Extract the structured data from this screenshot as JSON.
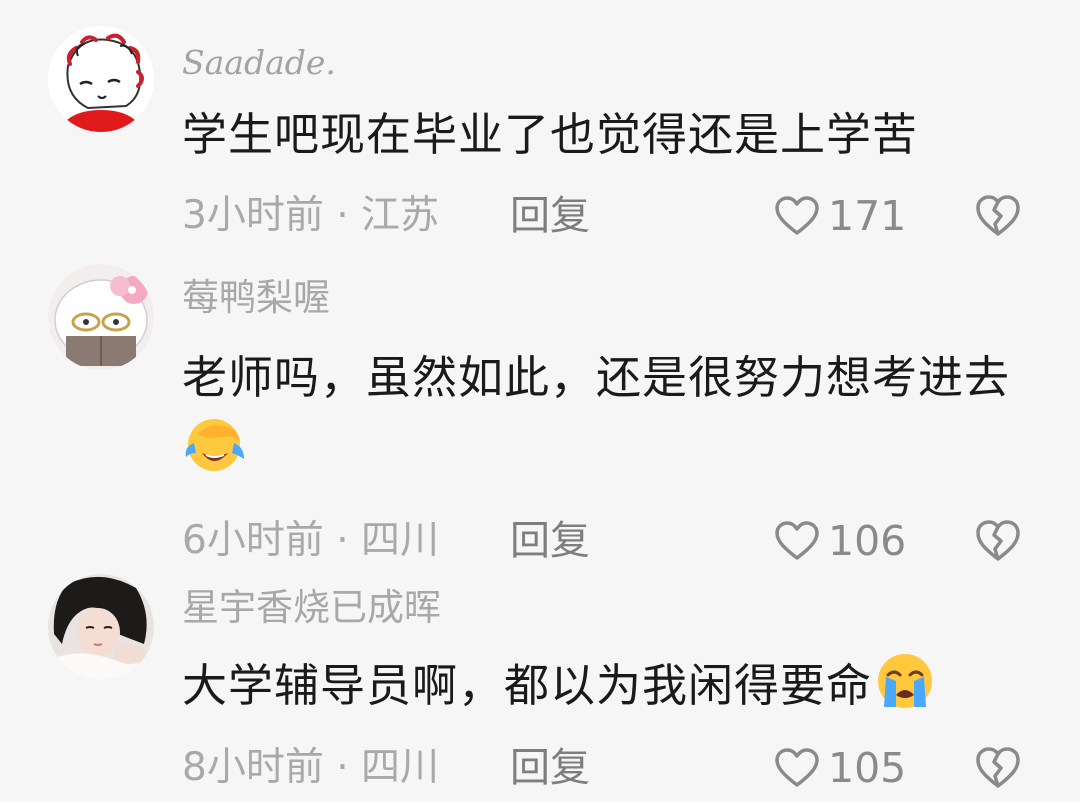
{
  "comments": [
    {
      "username": "Saadade.",
      "content": "学生吧现在毕业了也觉得还是上学苦",
      "time": "3小时前",
      "separator": " · ",
      "location": "江苏",
      "reply_label": "回复",
      "likes": "171",
      "emoji": ""
    },
    {
      "username": "莓鸭梨喔",
      "content": "老师吗，虽然如此，还是很努力想考进去",
      "time": "6小时前",
      "separator": " · ",
      "location": "四川",
      "reply_label": "回复",
      "likes": "106",
      "emoji": "face-palm-tears-emoji"
    },
    {
      "username": "星宇香烧已成晖",
      "content": "大学辅导员啊，都以为我闲得要命",
      "time": "8小时前",
      "separator": " · ",
      "location": "四川",
      "reply_label": "回复",
      "likes": "105",
      "emoji": "crying-face-emoji"
    }
  ],
  "icons": {
    "like": "heart-outline-icon",
    "dislike": "broken-heart-icon"
  },
  "colors": {
    "background": "#f6f6f6",
    "text": "#1a1a1a",
    "muted": "#a9a9a9",
    "icon": "#8a8a8a"
  }
}
